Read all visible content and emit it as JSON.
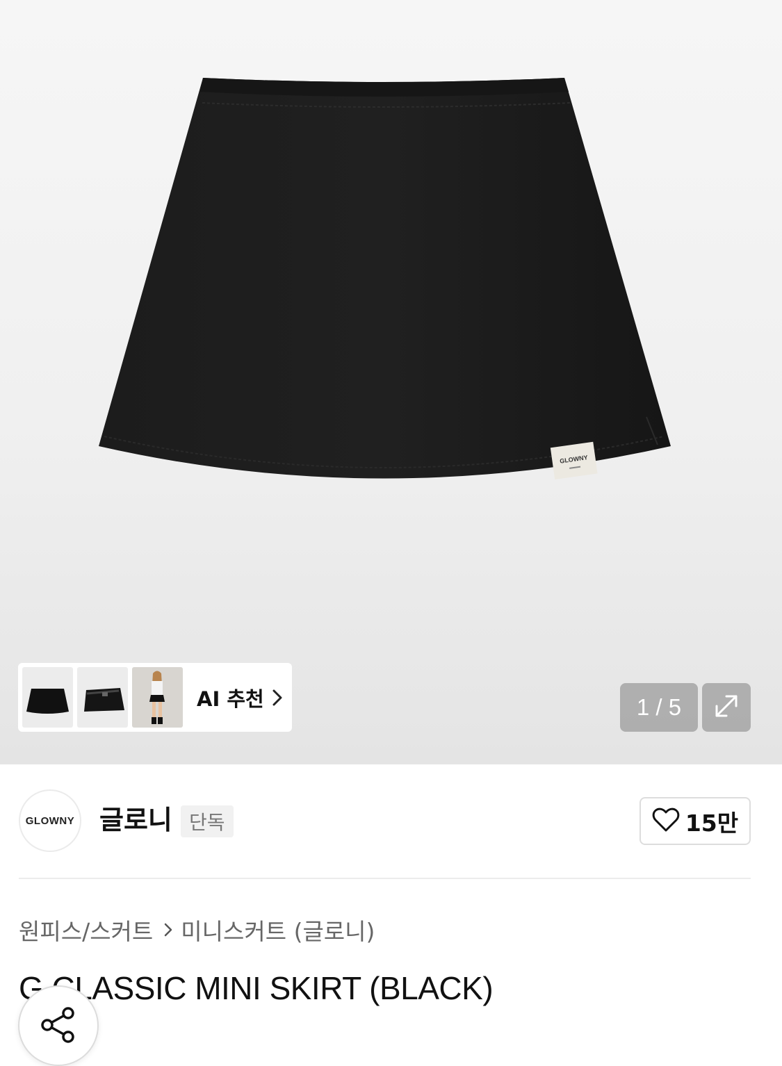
{
  "gallery": {
    "counter": "1 / 5",
    "ai_recommend_label": "AI 추천",
    "label_text": "GLOWNY",
    "thumbnails": [
      "skirt-front",
      "skort-wrap",
      "model-look"
    ]
  },
  "brand": {
    "logo_text": "GLOWNY",
    "name": "글로니",
    "badge": "단독",
    "like_count": "15만"
  },
  "breadcrumb": {
    "category": "원피스/스커트",
    "subcategory": "미니스커트 (글로니)"
  },
  "product": {
    "title": "G CLASSIC MINI SKIRT (BLACK)"
  },
  "icons": {
    "like": "heart-outline-icon",
    "expand": "expand-diagonal-icon",
    "share": "share-icon",
    "chevron": "chevron-right-icon"
  }
}
